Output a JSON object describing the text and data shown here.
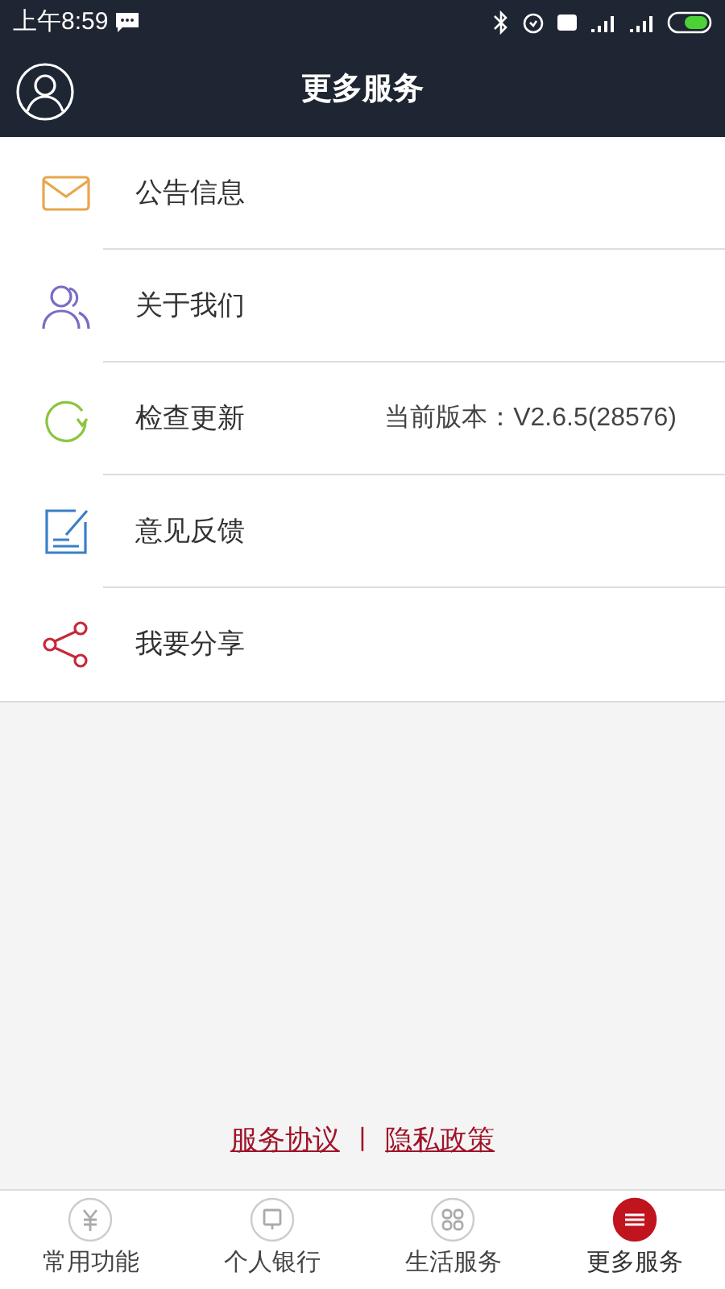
{
  "status_bar": {
    "time": "上午8:59"
  },
  "header": {
    "title": "更多服务"
  },
  "menu": [
    {
      "kind": "mail",
      "label": "公告信息"
    },
    {
      "kind": "people",
      "label": "关于我们"
    },
    {
      "kind": "refresh",
      "label": "检查更新",
      "value": "当前版本：V2.6.5(28576)"
    },
    {
      "kind": "feedback",
      "label": "意见反馈"
    },
    {
      "kind": "share",
      "label": "我要分享"
    }
  ],
  "footer_links": {
    "items": [
      "服务协议",
      "隐私政策"
    ],
    "separator": "|"
  },
  "tab_bar": [
    {
      "kind": "yuan",
      "label": "常用功能",
      "selected": false
    },
    {
      "kind": "screen",
      "label": "个人银行",
      "selected": false
    },
    {
      "kind": "grid",
      "label": "生活服务",
      "selected": false
    },
    {
      "kind": "menu",
      "label": "更多服务",
      "selected": true
    }
  ]
}
